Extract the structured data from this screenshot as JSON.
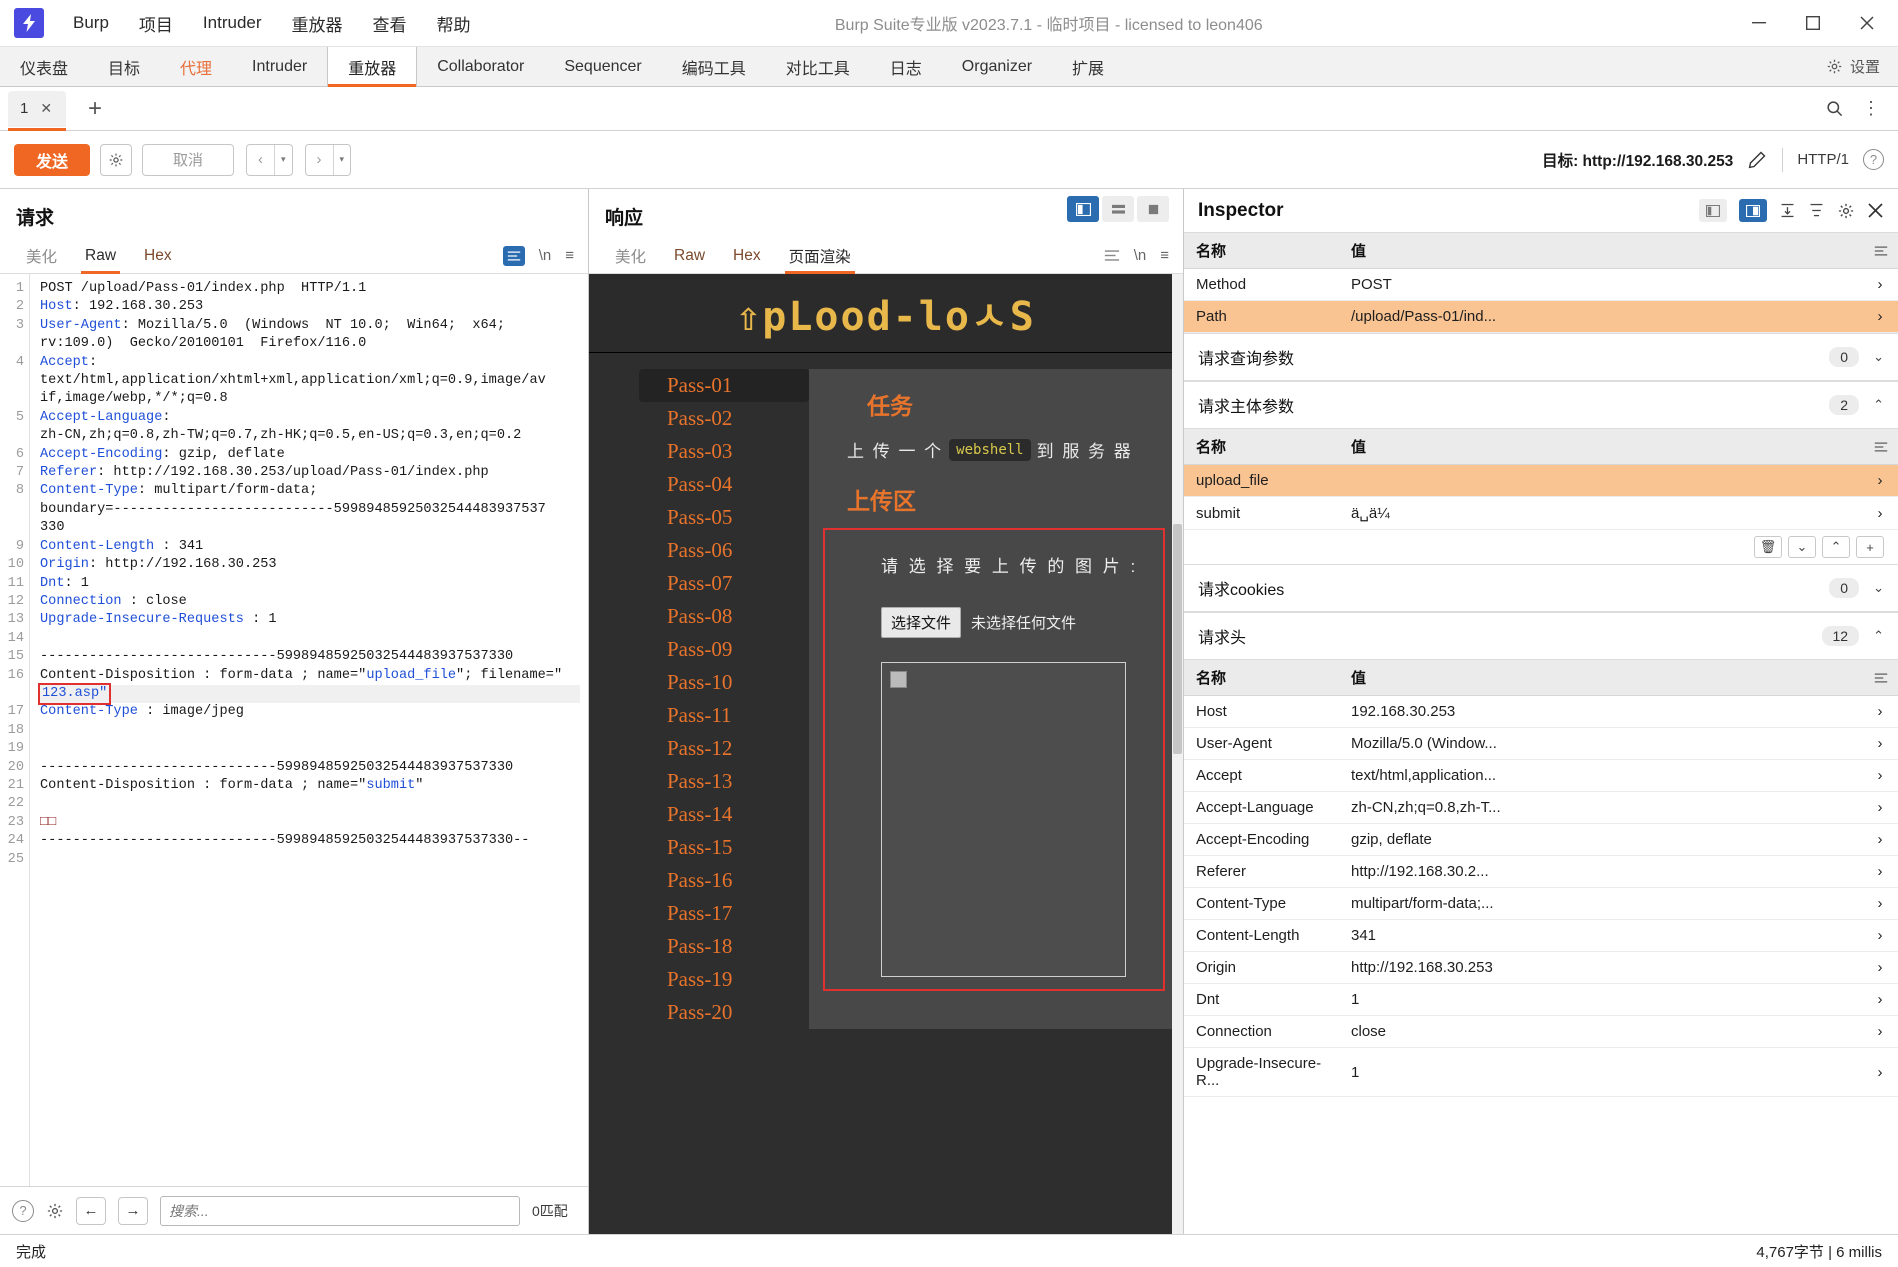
{
  "window": {
    "title": "Burp Suite专业版  v2023.7.1 - 临时项目 - licensed to leon406",
    "logo_glyph": "⚡",
    "minimize": "—",
    "maximize": "▢",
    "close": "✕"
  },
  "menubar": {
    "items": [
      "Burp",
      "项目",
      "Intruder",
      "重放器",
      "查看",
      "帮助"
    ]
  },
  "maintabs": {
    "items": [
      {
        "label": "仪表盘",
        "state": "normal"
      },
      {
        "label": "目标",
        "state": "normal"
      },
      {
        "label": "代理",
        "state": "proxy"
      },
      {
        "label": "Intruder",
        "state": "normal"
      },
      {
        "label": "重放器",
        "state": "active"
      },
      {
        "label": "Collaborator",
        "state": "normal"
      },
      {
        "label": "Sequencer",
        "state": "normal"
      },
      {
        "label": "编码工具",
        "state": "normal"
      },
      {
        "label": "对比工具",
        "state": "normal"
      },
      {
        "label": "日志",
        "state": "normal"
      },
      {
        "label": "Organizer",
        "state": "normal"
      },
      {
        "label": "扩展",
        "state": "normal"
      }
    ],
    "settings_label": "设置"
  },
  "repeater_tabs": {
    "tabs": [
      {
        "label": "1",
        "close": "✕"
      }
    ],
    "add_label": "+",
    "search_icon": "⌕",
    "menu_icon": "⋮"
  },
  "actionbar": {
    "send_label": "发送",
    "cancel_label": "取消",
    "prev_label": "‹",
    "next_label": "›",
    "caret": "▾",
    "target_label": "目标: http://192.168.30.253",
    "edit_icon": "✎",
    "http_version": "HTTP/1",
    "help_icon": "?"
  },
  "request": {
    "panel_title": "请求",
    "tabs": [
      {
        "label": "美化",
        "active": false
      },
      {
        "label": "Raw",
        "active": true
      },
      {
        "label": "Hex",
        "active": false
      }
    ],
    "lines": [
      {
        "n": "1",
        "text": "POST /upload/Pass-01/index.php  HTTP/1.1"
      },
      {
        "n": "2",
        "key": "Host",
        "text": ": 192.168.30.253"
      },
      {
        "n": "3",
        "key": "User-Agent",
        "text": ": Mozilla/5.0  (Windows  NT 10.0;  Win64;  x64;"
      },
      {
        "n": "",
        "text": "rv:109.0)  Gecko/20100101  Firefox/116.0"
      },
      {
        "n": "4",
        "key": "Accept",
        "text": ":"
      },
      {
        "n": "",
        "text": "text/html,application/xhtml+xml,application/xml;q=0.9,image/av"
      },
      {
        "n": "",
        "text": "if,image/webp,*/*;q=0.8"
      },
      {
        "n": "5",
        "key": "Accept-Language",
        "text": ":"
      },
      {
        "n": "",
        "text": "zh-CN,zh;q=0.8,zh-TW;q=0.7,zh-HK;q=0.5,en-US;q=0.3,en;q=0.2"
      },
      {
        "n": "6",
        "key": "Accept-Encoding",
        "text": ": gzip, deflate"
      },
      {
        "n": "7",
        "key": "Referer",
        "text": ": http://192.168.30.253/upload/Pass-01/index.php"
      },
      {
        "n": "8",
        "key": "Content-Type",
        "text": ": multipart/form-data;"
      },
      {
        "n": "",
        "text": "boundary=---------------------------59989485925032544483937537"
      },
      {
        "n": "",
        "text": "330"
      },
      {
        "n": "9",
        "key": "Content-Length",
        "text": " : 341"
      },
      {
        "n": "10",
        "key": "Origin",
        "text": ": http://192.168.30.253"
      },
      {
        "n": "11",
        "key": "Dnt",
        "text": ": 1"
      },
      {
        "n": "12",
        "key": "Connection",
        "text": " : close"
      },
      {
        "n": "13",
        "key": "Upgrade-Insecure-Requests",
        "text": " : 1"
      },
      {
        "n": "14",
        "text": ""
      },
      {
        "n": "15",
        "text": "-----------------------------59989485925032544483937537330"
      },
      {
        "n": "16",
        "text": "Content-Disposition : form-data ; name=\"upload_file\"; filename=\""
      }
    ],
    "highlight_line": {
      "n": "",
      "text": "123.asp\""
    },
    "lines_after": [
      {
        "n": "17",
        "key": "Content-Type",
        "text": " : image/jpeg"
      },
      {
        "n": "18",
        "text": ""
      },
      {
        "n": "19",
        "text": ""
      },
      {
        "n": "20",
        "text": "-----------------------------59989485925032544483937537330"
      },
      {
        "n": "21",
        "text": "Content-Disposition : form-data ; name=\"submit\""
      },
      {
        "n": "22",
        "text": ""
      },
      {
        "n": "23",
        "text": "□□",
        "red": true
      },
      {
        "n": "24",
        "text": "-----------------------------59989485925032544483937537330--"
      },
      {
        "n": "25",
        "text": ""
      }
    ],
    "search_placeholder": "搜索...",
    "match_label": "0匹配",
    "help_icon": "?",
    "gear_icon": "⚙",
    "back_icon": "←",
    "forward_icon": "→"
  },
  "response": {
    "panel_title": "响应",
    "tabs": [
      {
        "label": "美化",
        "active": false
      },
      {
        "label": "Raw",
        "active": false
      },
      {
        "label": "Hex",
        "active": false
      },
      {
        "label": "页面渲染",
        "active": true
      }
    ],
    "view_buttons": [
      "split-columns-icon",
      "split-rows-icon",
      "single-pane-icon"
    ],
    "render": {
      "site_logo": "⇧pLood-loㅅS",
      "nav_items": [
        "Pass-01",
        "Pass-02",
        "Pass-03",
        "Pass-04",
        "Pass-05",
        "Pass-06",
        "Pass-07",
        "Pass-08",
        "Pass-09",
        "Pass-10",
        "Pass-11",
        "Pass-12",
        "Pass-13",
        "Pass-14",
        "Pass-15",
        "Pass-16",
        "Pass-17",
        "Pass-18",
        "Pass-19",
        "Pass-20"
      ],
      "selected_nav": "Pass-01",
      "task_heading": "任务",
      "task_text_before": "上 传 一 个",
      "task_chip": "webshell",
      "task_text_after": "到 服 务 器",
      "upload_heading": "上传区",
      "file_label": "请 选 择 要 上 传 的 图 片 :",
      "file_button": "选择文件",
      "file_status": "未选择任何文件"
    }
  },
  "inspector": {
    "title": "Inspector",
    "tools": [
      "panel-left-icon",
      "panel-right-icon",
      "expand-all-icon",
      "collapse-all-icon",
      "gear-icon",
      "close-icon"
    ],
    "request_attrs": {
      "headers": [
        "名称",
        "值"
      ],
      "rows": [
        {
          "name": "Method",
          "value": "POST",
          "highlight": false
        },
        {
          "name": "Path",
          "value": "/upload/Pass-01/ind...",
          "highlight": true
        }
      ]
    },
    "sections": [
      {
        "title": "请求查询参数",
        "count": "0",
        "expanded": false
      },
      {
        "title": "请求主体参数",
        "count": "2",
        "expanded": true
      },
      {
        "title": "请求cookies",
        "count": "0",
        "expanded": false
      },
      {
        "title": "请求头",
        "count": "12",
        "expanded": true
      }
    ],
    "body_params": {
      "headers": [
        "名称",
        "值"
      ],
      "rows": [
        {
          "name": "upload_file",
          "value": "",
          "highlight": true
        },
        {
          "name": "submit",
          "value": "ä␣ä¼",
          "highlight": false
        }
      ],
      "toolbar": [
        "delete-icon",
        "chevron-down-icon",
        "chevron-up-icon",
        "add-icon"
      ]
    },
    "headers_table": {
      "headers": [
        "名称",
        "值"
      ],
      "rows": [
        {
          "name": "Host",
          "value": "192.168.30.253"
        },
        {
          "name": "User-Agent",
          "value": "Mozilla/5.0 (Window..."
        },
        {
          "name": "Accept",
          "value": "text/html,application..."
        },
        {
          "name": "Accept-Language",
          "value": "zh-CN,zh;q=0.8,zh-T..."
        },
        {
          "name": "Accept-Encoding",
          "value": "gzip, deflate"
        },
        {
          "name": "Referer",
          "value": "http://192.168.30.2..."
        },
        {
          "name": "Content-Type",
          "value": "multipart/form-data;..."
        },
        {
          "name": "Content-Length",
          "value": "341"
        },
        {
          "name": "Origin",
          "value": "http://192.168.30.253"
        },
        {
          "name": "Dnt",
          "value": "1"
        },
        {
          "name": "Connection",
          "value": "close"
        },
        {
          "name": "Upgrade-Insecure-R...",
          "value": "1"
        }
      ]
    }
  },
  "statusbar": {
    "left": "完成",
    "right": "4,767字节 | 6 millis"
  },
  "colors": {
    "accent_orange": "#ef6723",
    "highlight_peach": "#f9c392",
    "blue_active": "#2b6cb0",
    "link_blue": "#1f4fd8"
  }
}
